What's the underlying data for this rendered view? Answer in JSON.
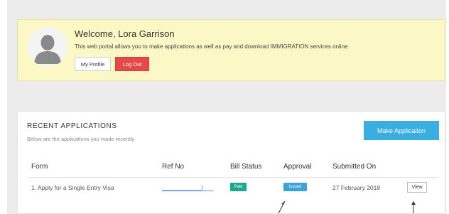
{
  "welcome": {
    "title": "Welcome, Lora Garrison",
    "description": "This web portal allows you to make applications as well as pay and download IMMIGRATION services online",
    "my_profile_label": "My Profile",
    "logout_label": "Log Out"
  },
  "applications": {
    "title": "RECENT APPLICATIONS",
    "subtitle": "Below are the applications you made recently",
    "make_application_label": "Make Applicaiton",
    "columns": [
      "Form",
      "Ref No",
      "Bill Status",
      "Approval",
      "Submitted On"
    ],
    "rows": [
      {
        "form": "1. Apply for a Single Entry Visa",
        "ref_no": "______________)",
        "bill_status": "Paid",
        "approval": "Issued",
        "submitted_on": "27 February 2018",
        "action": "View"
      }
    ]
  },
  "colors": {
    "welcome_bg": "#fbf8c6",
    "logout": "#e8474a",
    "make_application": "#3aaee0",
    "paid": "#1aa98f",
    "issued": "#3aa3d8"
  },
  "icons": [
    "avatar-silhouette-icon",
    "arrow-annotation-icon"
  ]
}
